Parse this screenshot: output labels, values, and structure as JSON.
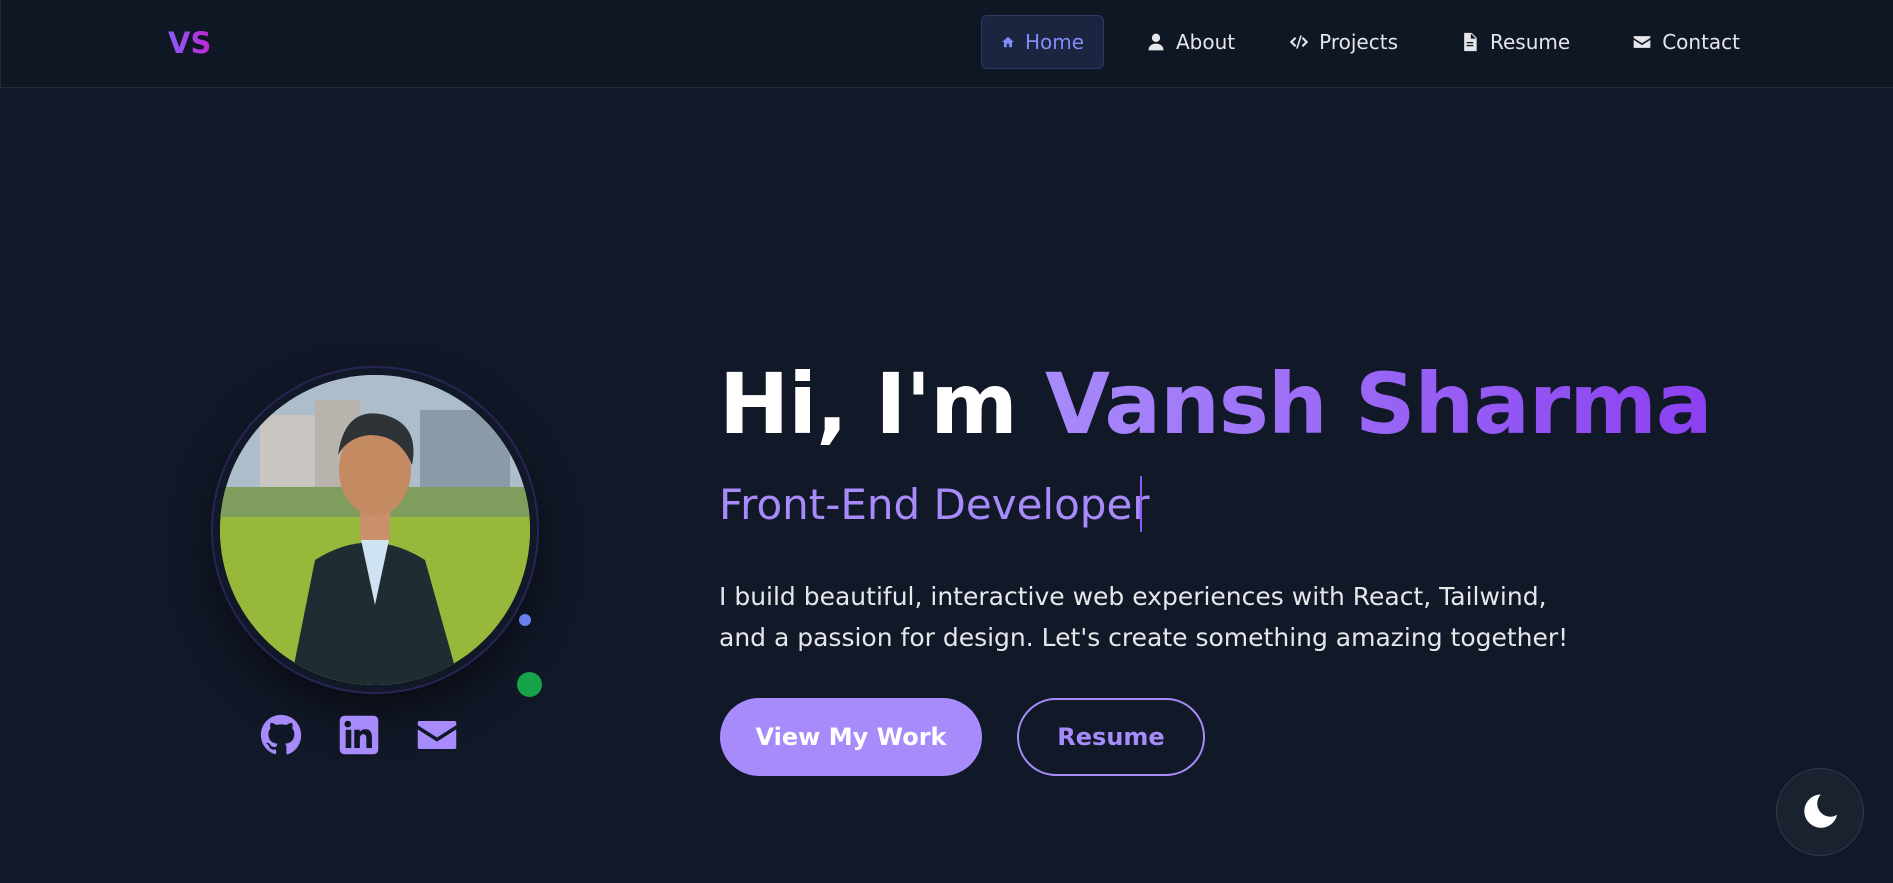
{
  "logo": "VS",
  "nav": {
    "items": [
      {
        "label": "Home",
        "icon": "home-icon",
        "active": true
      },
      {
        "label": "About",
        "icon": "user-icon"
      },
      {
        "label": "Projects",
        "icon": "code-icon"
      },
      {
        "label": "Resume",
        "icon": "file-icon"
      },
      {
        "label": "Contact",
        "icon": "envelope-icon"
      }
    ]
  },
  "hero": {
    "greeting": "Hi, I'm",
    "name": "Vansh Sharma",
    "role": "Front-End Developer",
    "description": "I build beautiful, interactive web experiences with React, Tailwind, and a passion for design. Let's create something amazing together!",
    "primary_button": "View My Work",
    "secondary_button": "Resume"
  },
  "socials": [
    "github-icon",
    "linkedin-icon",
    "envelope-icon"
  ],
  "colors": {
    "background": "#111827",
    "accent": "#a78bfa",
    "nav_active": "#818cf8",
    "status_green": "#16a34a"
  },
  "theme_toggle_icon": "moon-icon"
}
